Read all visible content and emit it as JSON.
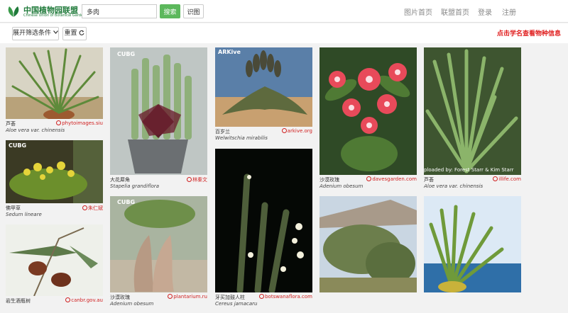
{
  "header": {
    "logo_cn": "中国植物园联盟",
    "logo_en": "Chinese Union of Botanical Gardens",
    "search_value": "多肉",
    "search_button": "搜索",
    "recognize_button": "识图",
    "nav": [
      "图片首页",
      "联盟首页",
      "登录",
      "注册"
    ]
  },
  "toolbar": {
    "filter_label": "展开筛选条件",
    "reset_label": "重置",
    "hint": "点击学名查看物种信息"
  },
  "cards": [
    {
      "cn": "芦荟",
      "sci": "Aloe vera var. chinensis",
      "source": "phytoimages.siu"
    },
    {
      "cn": "佛甲草",
      "sci": "Sedum lineare",
      "source": "朱仁斌"
    },
    {
      "cn": "岩生酒瓶树",
      "sci": "",
      "source": "canbr.gov.au"
    },
    {
      "cn": "大花犀角",
      "sci": "Stapelia grandiflora",
      "source": "林秦文",
      "watermark": "CUBG"
    },
    {
      "cn": "沙漠玫瑰",
      "sci": "Adenium obesum",
      "source": "plantarium.ru",
      "watermark": "CUBG"
    },
    {
      "cn": "百岁兰",
      "sci": "Welwitschia mirabilis",
      "source": "arkive.org",
      "watermark": "ARKive"
    },
    {
      "cn": "牙买加鼓人柱",
      "sci": "Cereus jamacaru",
      "source": "botswanaflora.com"
    },
    {
      "cn": "沙漠玫瑰",
      "sci": "Adenium obesum",
      "source": "davesgarden.com"
    },
    {
      "cn": "",
      "sci": "",
      "source": ""
    },
    {
      "cn": "芦荟",
      "sci": "Aloe vera var. chinensis",
      "source": "illife.com",
      "watermark": "ploaded by: Forest Starr & Kim Starr"
    },
    {
      "cn": "",
      "sci": "",
      "source": ""
    }
  ]
}
